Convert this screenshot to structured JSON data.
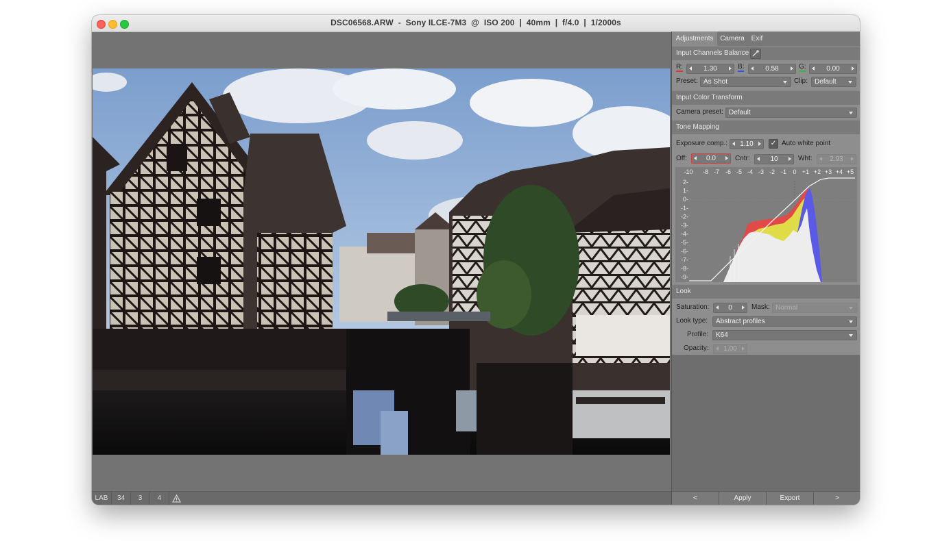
{
  "window": {
    "title": "DSC06568.ARW  -  Sony ILCE-7M3  @  ISO 200  |  40mm  |  f/4.0  |  1/2000s"
  },
  "statusbar": {
    "items": [
      "LAB",
      "34",
      "3",
      "4"
    ],
    "warning_icon": "warning-triangle-icon"
  },
  "tabs": [
    {
      "label": "Adjustments",
      "active": true
    },
    {
      "label": "Camera",
      "active": false
    },
    {
      "label": "Exif",
      "active": false
    }
  ],
  "input_channels": {
    "header": "Input Channels Balance",
    "picker_icon": "eyedropper-icon",
    "r_label": "R:",
    "r_value": "1.30",
    "b_label": "B:",
    "b_value": "0.58",
    "g_label": "G:",
    "g_value": "0.00",
    "preset_label": "Preset:",
    "preset_value": "As Shot",
    "clip_label": "Clip:",
    "clip_value": "Default"
  },
  "input_color_transform": {
    "header": "Input Color Transform",
    "camera_preset_label": "Camera preset:",
    "camera_preset_value": "Default"
  },
  "tone_mapping": {
    "header": "Tone Mapping",
    "exposure_label": "Exposure comp.:",
    "exposure_value": "1.10",
    "auto_white_label": "Auto white point",
    "auto_white_checked": true,
    "off_label": "Off:",
    "off_value": "0.0",
    "cntr_label": "Cntr:",
    "cntr_value": "10",
    "wht_label": "Wht:",
    "wht_value": "2.93",
    "x_ticks": [
      "-10",
      "-8",
      "-7",
      "-6",
      "-5",
      "-4",
      "-3",
      "-2",
      "-1",
      "0",
      "+1",
      "+2",
      "+3",
      "+4",
      "+5"
    ],
    "y_ticks": [
      "2-",
      "1-",
      "0-",
      "-1-",
      "-2-",
      "-3-",
      "-4-",
      "-5-",
      "-6-",
      "-7-",
      "-8-",
      "-9-"
    ]
  },
  "look": {
    "header": "Look",
    "saturation_label": "Saturation:",
    "saturation_value": "0",
    "mask_label": "Mask:",
    "mask_value": "Normal",
    "look_type_label": "Look type:",
    "look_type_value": "Abstract profiles",
    "profile_label": "Profile:",
    "profile_value": "K64",
    "opacity_label": "Opacity:",
    "opacity_value": "1,00"
  },
  "bottom_buttons": [
    "<",
    "Apply",
    "Export",
    ">"
  ]
}
